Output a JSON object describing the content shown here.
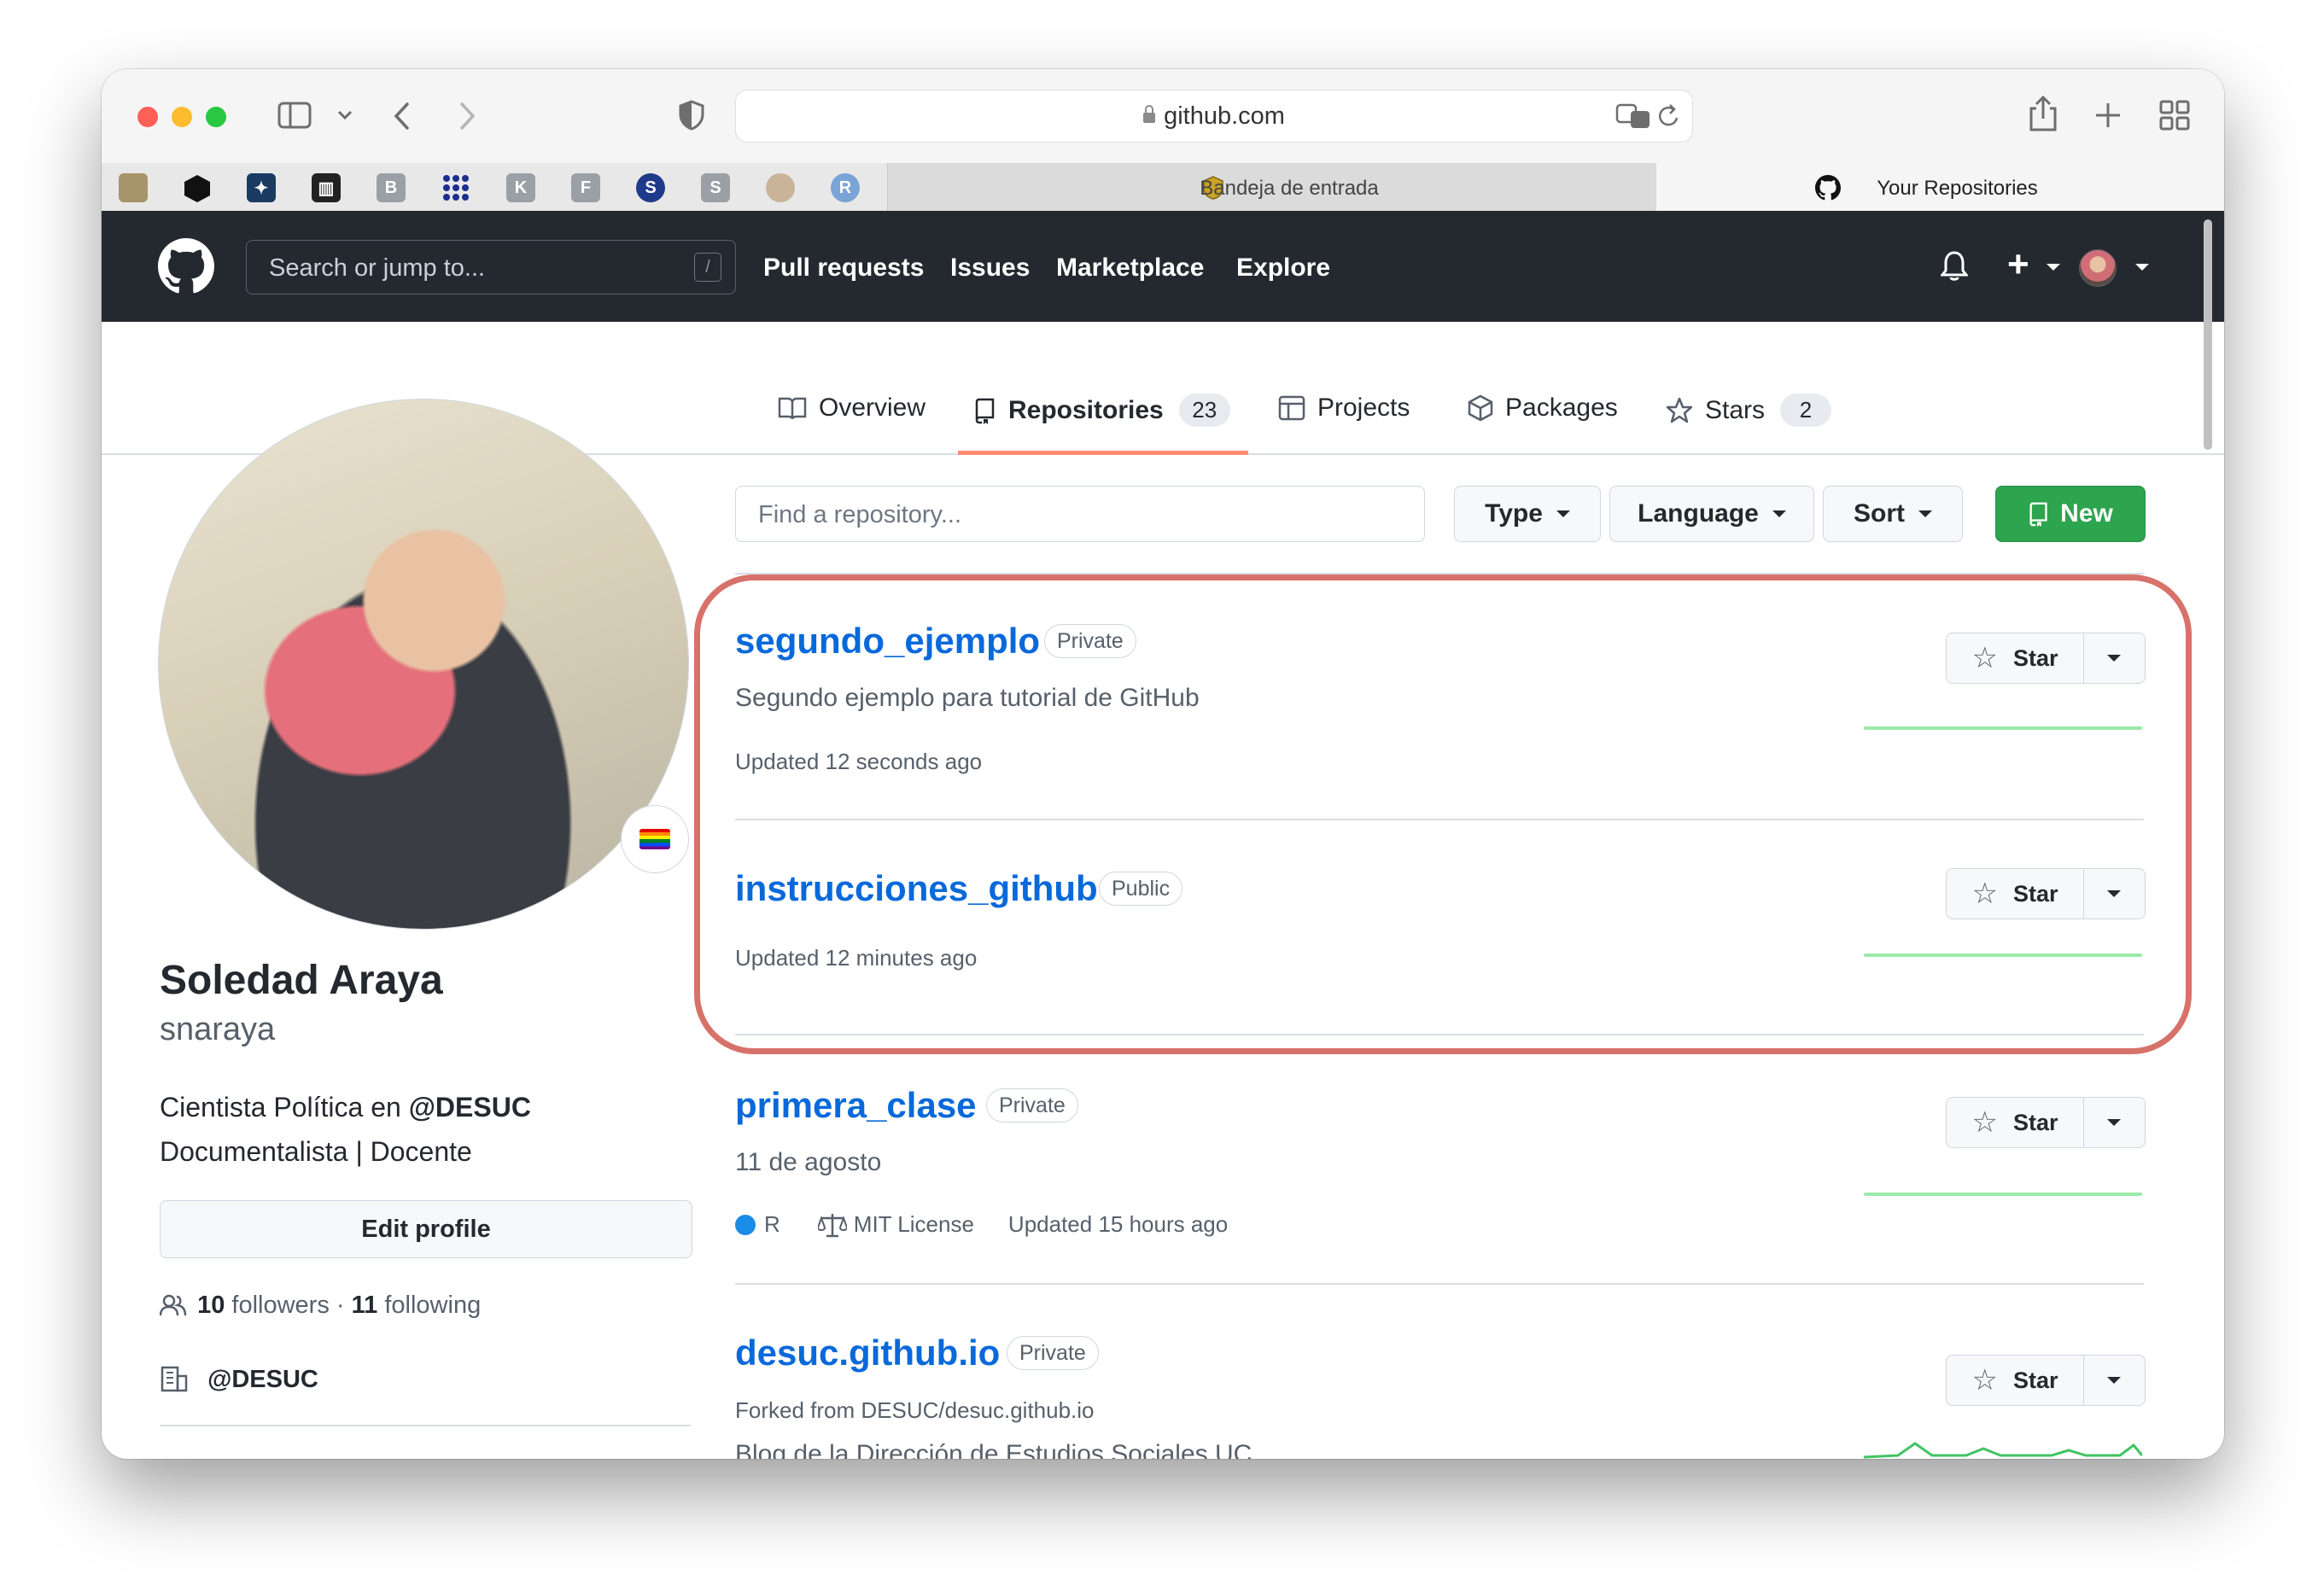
{
  "browser": {
    "url": "github.com",
    "tabs": [
      {
        "label": "Bandeja de entrada"
      },
      {
        "label": "Your Repositories"
      }
    ],
    "favorites": [
      "B",
      "K",
      "F",
      "S",
      "R"
    ]
  },
  "header": {
    "search_placeholder": "Search or jump to...",
    "search_shortcut": "/",
    "nav": [
      "Pull requests",
      "Issues",
      "Marketplace",
      "Explore"
    ],
    "plus_label": "+"
  },
  "profile_tabs": [
    {
      "label": "Overview",
      "icon": "book-icon"
    },
    {
      "label": "Repositories",
      "icon": "repo-icon",
      "count": "23"
    },
    {
      "label": "Projects",
      "icon": "project-table-icon"
    },
    {
      "label": "Packages",
      "icon": "package-icon"
    },
    {
      "label": "Stars",
      "icon": "star-icon",
      "count": "2"
    }
  ],
  "profile": {
    "full_name": "Soledad Araya",
    "username": "snaraya",
    "bio_line1_prefix": "Cientista Política en ",
    "bio_line1_org": "@DESUC",
    "bio_line2": "Documentalista | Docente",
    "edit_button": "Edit profile",
    "followers_count": "10",
    "followers_label": "followers",
    "separator": "·",
    "following_count": "11",
    "following_label": "following",
    "organization": "@DESUC"
  },
  "filters": {
    "find_placeholder": "Find a repository...",
    "type_label": "Type",
    "language_label": "Language",
    "sort_label": "Sort",
    "new_label": "New"
  },
  "repos": [
    {
      "name": "segundo_ejemplo",
      "visibility": "Private",
      "description": "Segundo ejemplo para tutorial de GitHub",
      "updated": "Updated 12 seconds ago",
      "star_label": "Star"
    },
    {
      "name": "instrucciones_github",
      "visibility": "Public",
      "updated": "Updated 12 minutes ago",
      "star_label": "Star"
    },
    {
      "name": "primera_clase",
      "visibility": "Private",
      "description": "11 de agosto",
      "language": "R",
      "license": "MIT License",
      "updated": "Updated 15 hours ago",
      "star_label": "Star"
    },
    {
      "name": "desuc.github.io",
      "visibility": "Private",
      "forked_from": "Forked from DESUC/desuc.github.io",
      "description": "Blog de la Dirección de Estudios Sociales UC",
      "star_label": "Star"
    }
  ],
  "colors": {
    "header_bg": "#24292f",
    "link_blue": "#0969da",
    "new_button_green": "#2da44e",
    "highlight_annotation": "#d7726a",
    "active_tab_underline": "#fd8c73",
    "lang_r": "#198ce7"
  }
}
